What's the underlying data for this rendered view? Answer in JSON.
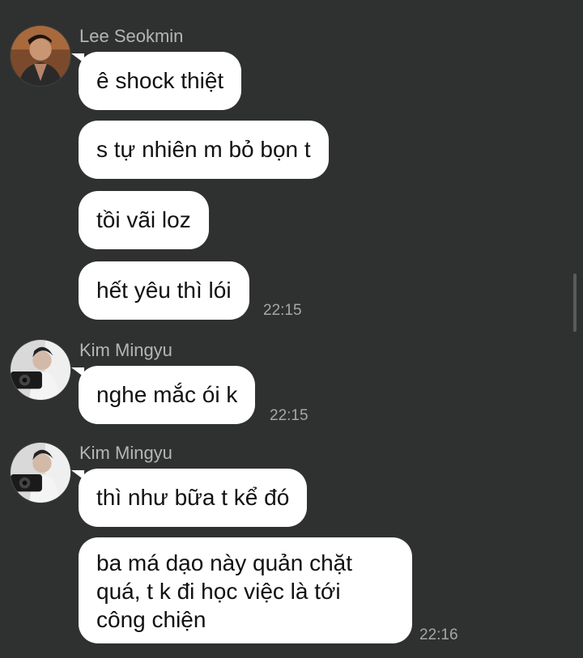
{
  "messages": [
    {
      "sender": "Lee Seokmin",
      "avatar": "lee-seokmin-avatar",
      "bubbles": [
        "ê shock thiệt",
        "s tự nhiên m bỏ bọn t",
        "tồi vãi loz",
        "hết yêu thì lói"
      ],
      "time": "22:15"
    },
    {
      "sender": "Kim Mingyu",
      "avatar": "kim-mingyu-avatar",
      "bubbles": [
        "nghe mắc ói k"
      ],
      "time": "22:15"
    },
    {
      "sender": "Kim Mingyu",
      "avatar": "kim-mingyu-avatar",
      "bubbles": [
        "thì như bữa t kể đó",
        "ba má dạo này quản chặt quá, t k đi học việc là tới công chiện"
      ],
      "time": "22:16"
    }
  ],
  "colors": {
    "background": "#2f3130",
    "bubble": "#ffffff",
    "bubble_text": "#111111",
    "sender_text": "#b4b6b5",
    "time_text": "#a5a7a6"
  }
}
